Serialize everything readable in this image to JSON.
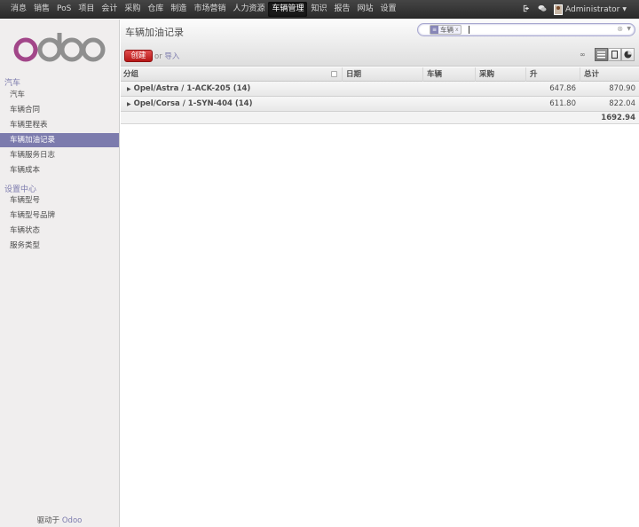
{
  "topmenu": {
    "items": [
      "消息",
      "销售",
      "PoS",
      "项目",
      "会计",
      "采购",
      "仓库",
      "制造",
      "市场营销",
      "人力资源",
      "车辆管理",
      "知识",
      "报告",
      "网站",
      "设置"
    ],
    "active_index": 10,
    "user": "Administrator"
  },
  "sidebar": {
    "logo_text": "odoo",
    "sections": [
      {
        "title": "汽车",
        "items": [
          "汽车",
          "车辆合同",
          "车辆里程表",
          "车辆加油记录",
          "车辆服务日志",
          "车辆成本"
        ]
      },
      {
        "title": "设置中心",
        "items": [
          "车辆型号",
          "车辆型号品牌",
          "车辆状态",
          "服务类型"
        ]
      }
    ],
    "active_item": "车辆加油记录",
    "powered_prefix": "驱动于",
    "powered_brand": "Odoo"
  },
  "main": {
    "title": "车辆加油记录",
    "search": {
      "facet_value": "车辆",
      "query": ""
    },
    "create_label": "创建",
    "or_label": "or",
    "import_label": "导入",
    "pager": "∞",
    "columns": [
      "分组",
      "日期",
      "车辆",
      "采购",
      "升",
      "总计"
    ],
    "groups": [
      {
        "name": "Opel/Astra / 1-ACK-205 (14)",
        "liters": "647.86",
        "total": "870.90"
      },
      {
        "name": "Opel/Corsa / 1-SYN-404 (14)",
        "liters": "611.80",
        "total": "822.04"
      }
    ],
    "grand_total": "1692.94"
  },
  "colors": {
    "accent": "#7c7bad",
    "create_button": "#c62a2a",
    "topbar": "#3a3a3a"
  }
}
